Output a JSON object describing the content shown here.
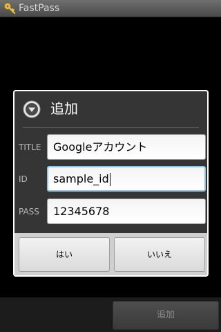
{
  "app": {
    "title": "FastPass",
    "icon": "key-icon"
  },
  "dialog": {
    "title": "追加",
    "header_icon": "chevron-down-circle-icon",
    "fields": [
      {
        "label": "TITLE",
        "value": "Googleアカウント"
      },
      {
        "label": "ID",
        "value": "sample_id"
      },
      {
        "label": "PASS",
        "value": "12345678"
      }
    ],
    "buttons": {
      "yes": "はい",
      "no": "いいえ"
    }
  },
  "bottom": {
    "add_label": "追加"
  },
  "colors": {
    "focus_border": "#8fc6e6",
    "dialog_bg": "#353535"
  }
}
